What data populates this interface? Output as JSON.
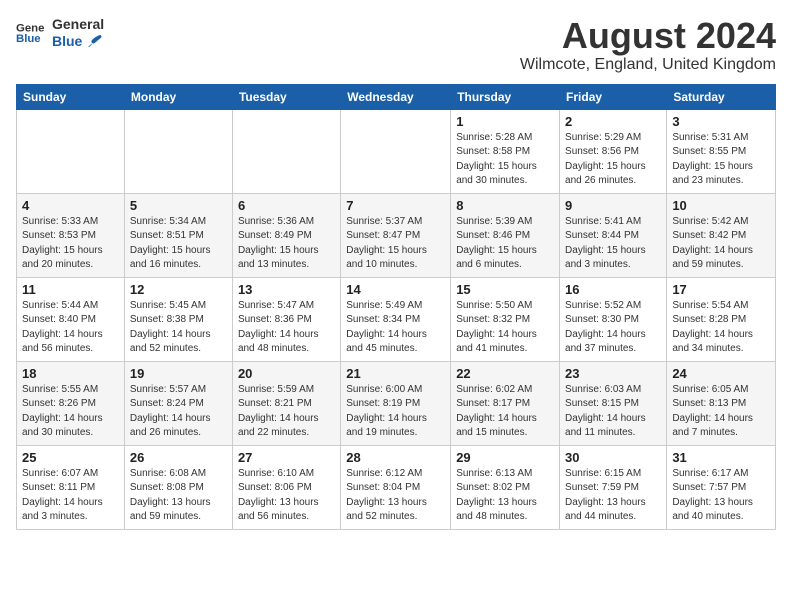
{
  "header": {
    "logo_line1": "General",
    "logo_line2": "Blue",
    "month": "August 2024",
    "location": "Wilmcote, England, United Kingdom"
  },
  "days_of_week": [
    "Sunday",
    "Monday",
    "Tuesday",
    "Wednesday",
    "Thursday",
    "Friday",
    "Saturday"
  ],
  "weeks": [
    [
      {
        "num": "",
        "info": ""
      },
      {
        "num": "",
        "info": ""
      },
      {
        "num": "",
        "info": ""
      },
      {
        "num": "",
        "info": ""
      },
      {
        "num": "1",
        "info": "Sunrise: 5:28 AM\nSunset: 8:58 PM\nDaylight: 15 hours\nand 30 minutes."
      },
      {
        "num": "2",
        "info": "Sunrise: 5:29 AM\nSunset: 8:56 PM\nDaylight: 15 hours\nand 26 minutes."
      },
      {
        "num": "3",
        "info": "Sunrise: 5:31 AM\nSunset: 8:55 PM\nDaylight: 15 hours\nand 23 minutes."
      }
    ],
    [
      {
        "num": "4",
        "info": "Sunrise: 5:33 AM\nSunset: 8:53 PM\nDaylight: 15 hours\nand 20 minutes."
      },
      {
        "num": "5",
        "info": "Sunrise: 5:34 AM\nSunset: 8:51 PM\nDaylight: 15 hours\nand 16 minutes."
      },
      {
        "num": "6",
        "info": "Sunrise: 5:36 AM\nSunset: 8:49 PM\nDaylight: 15 hours\nand 13 minutes."
      },
      {
        "num": "7",
        "info": "Sunrise: 5:37 AM\nSunset: 8:47 PM\nDaylight: 15 hours\nand 10 minutes."
      },
      {
        "num": "8",
        "info": "Sunrise: 5:39 AM\nSunset: 8:46 PM\nDaylight: 15 hours\nand 6 minutes."
      },
      {
        "num": "9",
        "info": "Sunrise: 5:41 AM\nSunset: 8:44 PM\nDaylight: 15 hours\nand 3 minutes."
      },
      {
        "num": "10",
        "info": "Sunrise: 5:42 AM\nSunset: 8:42 PM\nDaylight: 14 hours\nand 59 minutes."
      }
    ],
    [
      {
        "num": "11",
        "info": "Sunrise: 5:44 AM\nSunset: 8:40 PM\nDaylight: 14 hours\nand 56 minutes."
      },
      {
        "num": "12",
        "info": "Sunrise: 5:45 AM\nSunset: 8:38 PM\nDaylight: 14 hours\nand 52 minutes."
      },
      {
        "num": "13",
        "info": "Sunrise: 5:47 AM\nSunset: 8:36 PM\nDaylight: 14 hours\nand 48 minutes."
      },
      {
        "num": "14",
        "info": "Sunrise: 5:49 AM\nSunset: 8:34 PM\nDaylight: 14 hours\nand 45 minutes."
      },
      {
        "num": "15",
        "info": "Sunrise: 5:50 AM\nSunset: 8:32 PM\nDaylight: 14 hours\nand 41 minutes."
      },
      {
        "num": "16",
        "info": "Sunrise: 5:52 AM\nSunset: 8:30 PM\nDaylight: 14 hours\nand 37 minutes."
      },
      {
        "num": "17",
        "info": "Sunrise: 5:54 AM\nSunset: 8:28 PM\nDaylight: 14 hours\nand 34 minutes."
      }
    ],
    [
      {
        "num": "18",
        "info": "Sunrise: 5:55 AM\nSunset: 8:26 PM\nDaylight: 14 hours\nand 30 minutes."
      },
      {
        "num": "19",
        "info": "Sunrise: 5:57 AM\nSunset: 8:24 PM\nDaylight: 14 hours\nand 26 minutes."
      },
      {
        "num": "20",
        "info": "Sunrise: 5:59 AM\nSunset: 8:21 PM\nDaylight: 14 hours\nand 22 minutes."
      },
      {
        "num": "21",
        "info": "Sunrise: 6:00 AM\nSunset: 8:19 PM\nDaylight: 14 hours\nand 19 minutes."
      },
      {
        "num": "22",
        "info": "Sunrise: 6:02 AM\nSunset: 8:17 PM\nDaylight: 14 hours\nand 15 minutes."
      },
      {
        "num": "23",
        "info": "Sunrise: 6:03 AM\nSunset: 8:15 PM\nDaylight: 14 hours\nand 11 minutes."
      },
      {
        "num": "24",
        "info": "Sunrise: 6:05 AM\nSunset: 8:13 PM\nDaylight: 14 hours\nand 7 minutes."
      }
    ],
    [
      {
        "num": "25",
        "info": "Sunrise: 6:07 AM\nSunset: 8:11 PM\nDaylight: 14 hours\nand 3 minutes."
      },
      {
        "num": "26",
        "info": "Sunrise: 6:08 AM\nSunset: 8:08 PM\nDaylight: 13 hours\nand 59 minutes."
      },
      {
        "num": "27",
        "info": "Sunrise: 6:10 AM\nSunset: 8:06 PM\nDaylight: 13 hours\nand 56 minutes."
      },
      {
        "num": "28",
        "info": "Sunrise: 6:12 AM\nSunset: 8:04 PM\nDaylight: 13 hours\nand 52 minutes."
      },
      {
        "num": "29",
        "info": "Sunrise: 6:13 AM\nSunset: 8:02 PM\nDaylight: 13 hours\nand 48 minutes."
      },
      {
        "num": "30",
        "info": "Sunrise: 6:15 AM\nSunset: 7:59 PM\nDaylight: 13 hours\nand 44 minutes."
      },
      {
        "num": "31",
        "info": "Sunrise: 6:17 AM\nSunset: 7:57 PM\nDaylight: 13 hours\nand 40 minutes."
      }
    ]
  ]
}
